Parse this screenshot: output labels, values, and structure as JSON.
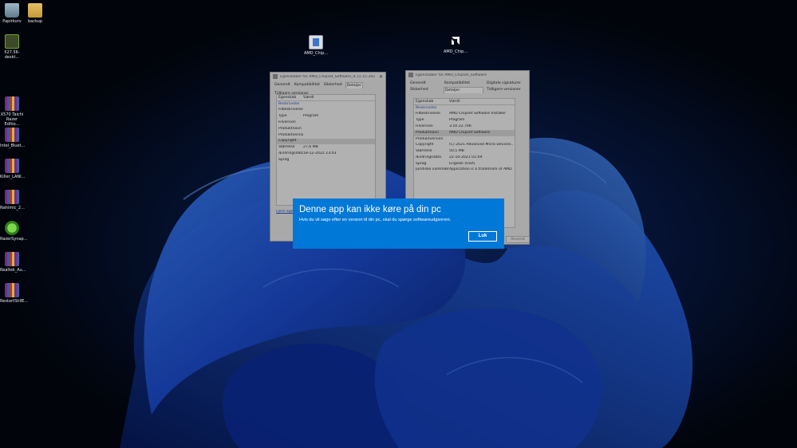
{
  "desktop_icons": [
    {
      "label": "Papirkurv",
      "icon": "recycle-bin-icon"
    },
    {
      "label": "backup",
      "icon": "folder-icon"
    },
    {
      "label": "527.56-deskt...",
      "icon": "nvidia-installer-icon"
    },
    {
      "label": "X570 Taichi Razer Editio...",
      "icon": "winrar-archive-icon"
    },
    {
      "label": "Intel_Bluet...",
      "icon": "winrar-archive-icon"
    },
    {
      "label": "Killer_LANI...",
      "icon": "winrar-archive-icon"
    },
    {
      "label": "Nahimic_2...",
      "icon": "winrar-archive-icon"
    },
    {
      "label": "RazerSynap...",
      "icon": "razer-synapse-icon"
    },
    {
      "label": "Realtek_Au...",
      "icon": "winrar-archive-icon"
    },
    {
      "label": "RestartStillE...",
      "icon": "winrar-archive-icon"
    },
    {
      "label": "AMD_Chip...",
      "icon": "amd-installer-icon"
    },
    {
      "label": "AMD_Chip...",
      "icon": "amd-installer-icon"
    }
  ],
  "window1": {
    "title": "Egenskaber for AMD_Chipset_Software_4.11.15.342",
    "tabs": [
      "Generelt",
      "Kompatibilitet",
      "Sikkerhed",
      "Detaljer",
      "Tidligere versioner"
    ],
    "active_tab": "Detaljer",
    "col_property": "Egenskab",
    "col_value": "Værdi",
    "section": "Beskrivelse",
    "rows": [
      {
        "k": "Filbeskrivelse",
        "v": ""
      },
      {
        "k": "Type",
        "v": "Program"
      },
      {
        "k": "Filversion",
        "v": ""
      },
      {
        "k": "Produktnavn",
        "v": ""
      },
      {
        "k": "Produktversion",
        "v": ""
      },
      {
        "k": "Copyright",
        "v": ""
      },
      {
        "k": "Størrelse",
        "v": "27,6 MB"
      },
      {
        "k": "Ændringsdato",
        "v": "18-12-2022 23:43"
      },
      {
        "k": "Sprog",
        "v": ""
      }
    ],
    "link": "Fjern egenskaber og personlige oplysninger"
  },
  "window2": {
    "title": "Egenskaber for AMD_Chipset_Software",
    "tabs": [
      "Generelt",
      "Kompatibilitet",
      "Digitale signaturer",
      "Sikkerhed",
      "Detaljer",
      "Tidligere versioner"
    ],
    "active_tab": "Detaljer",
    "col_property": "Egenskab",
    "col_value": "Værdi",
    "section": "Beskrivelse",
    "rows": [
      {
        "k": "Filbeskrivelse",
        "v": "AMD Chipset Software Installer"
      },
      {
        "k": "Type",
        "v": "Program"
      },
      {
        "k": "Filversion",
        "v": "3.10.22.706"
      },
      {
        "k": "Produktnavn",
        "v": "AMD Chipset Software"
      },
      {
        "k": "Produktversion",
        "v": ""
      },
      {
        "k": "Copyright",
        "v": "(C) 2021 Advanced Micro Devices..."
      },
      {
        "k": "Størrelse",
        "v": "50,5 MB"
      },
      {
        "k": "Ændringsdato",
        "v": "22-10-2021 01:09"
      },
      {
        "k": "Sprog",
        "v": "Engelsk (USA)"
      },
      {
        "k": "Juridiske varemærker",
        "v": "Application is a trademark of AMD I..."
      }
    ],
    "apply_button": "Anvend"
  },
  "dialog": {
    "title": "Denne app kan ikke køre på din pc",
    "message": "Hvis du vil søge efter en version til din pc, skal du spørge softwareudgiveren.",
    "button": "Luk"
  },
  "colors": {
    "dialog_background": "#0078d7",
    "wallpaper_base": "#030812",
    "wallpaper_accent": "#1f5ee0"
  }
}
